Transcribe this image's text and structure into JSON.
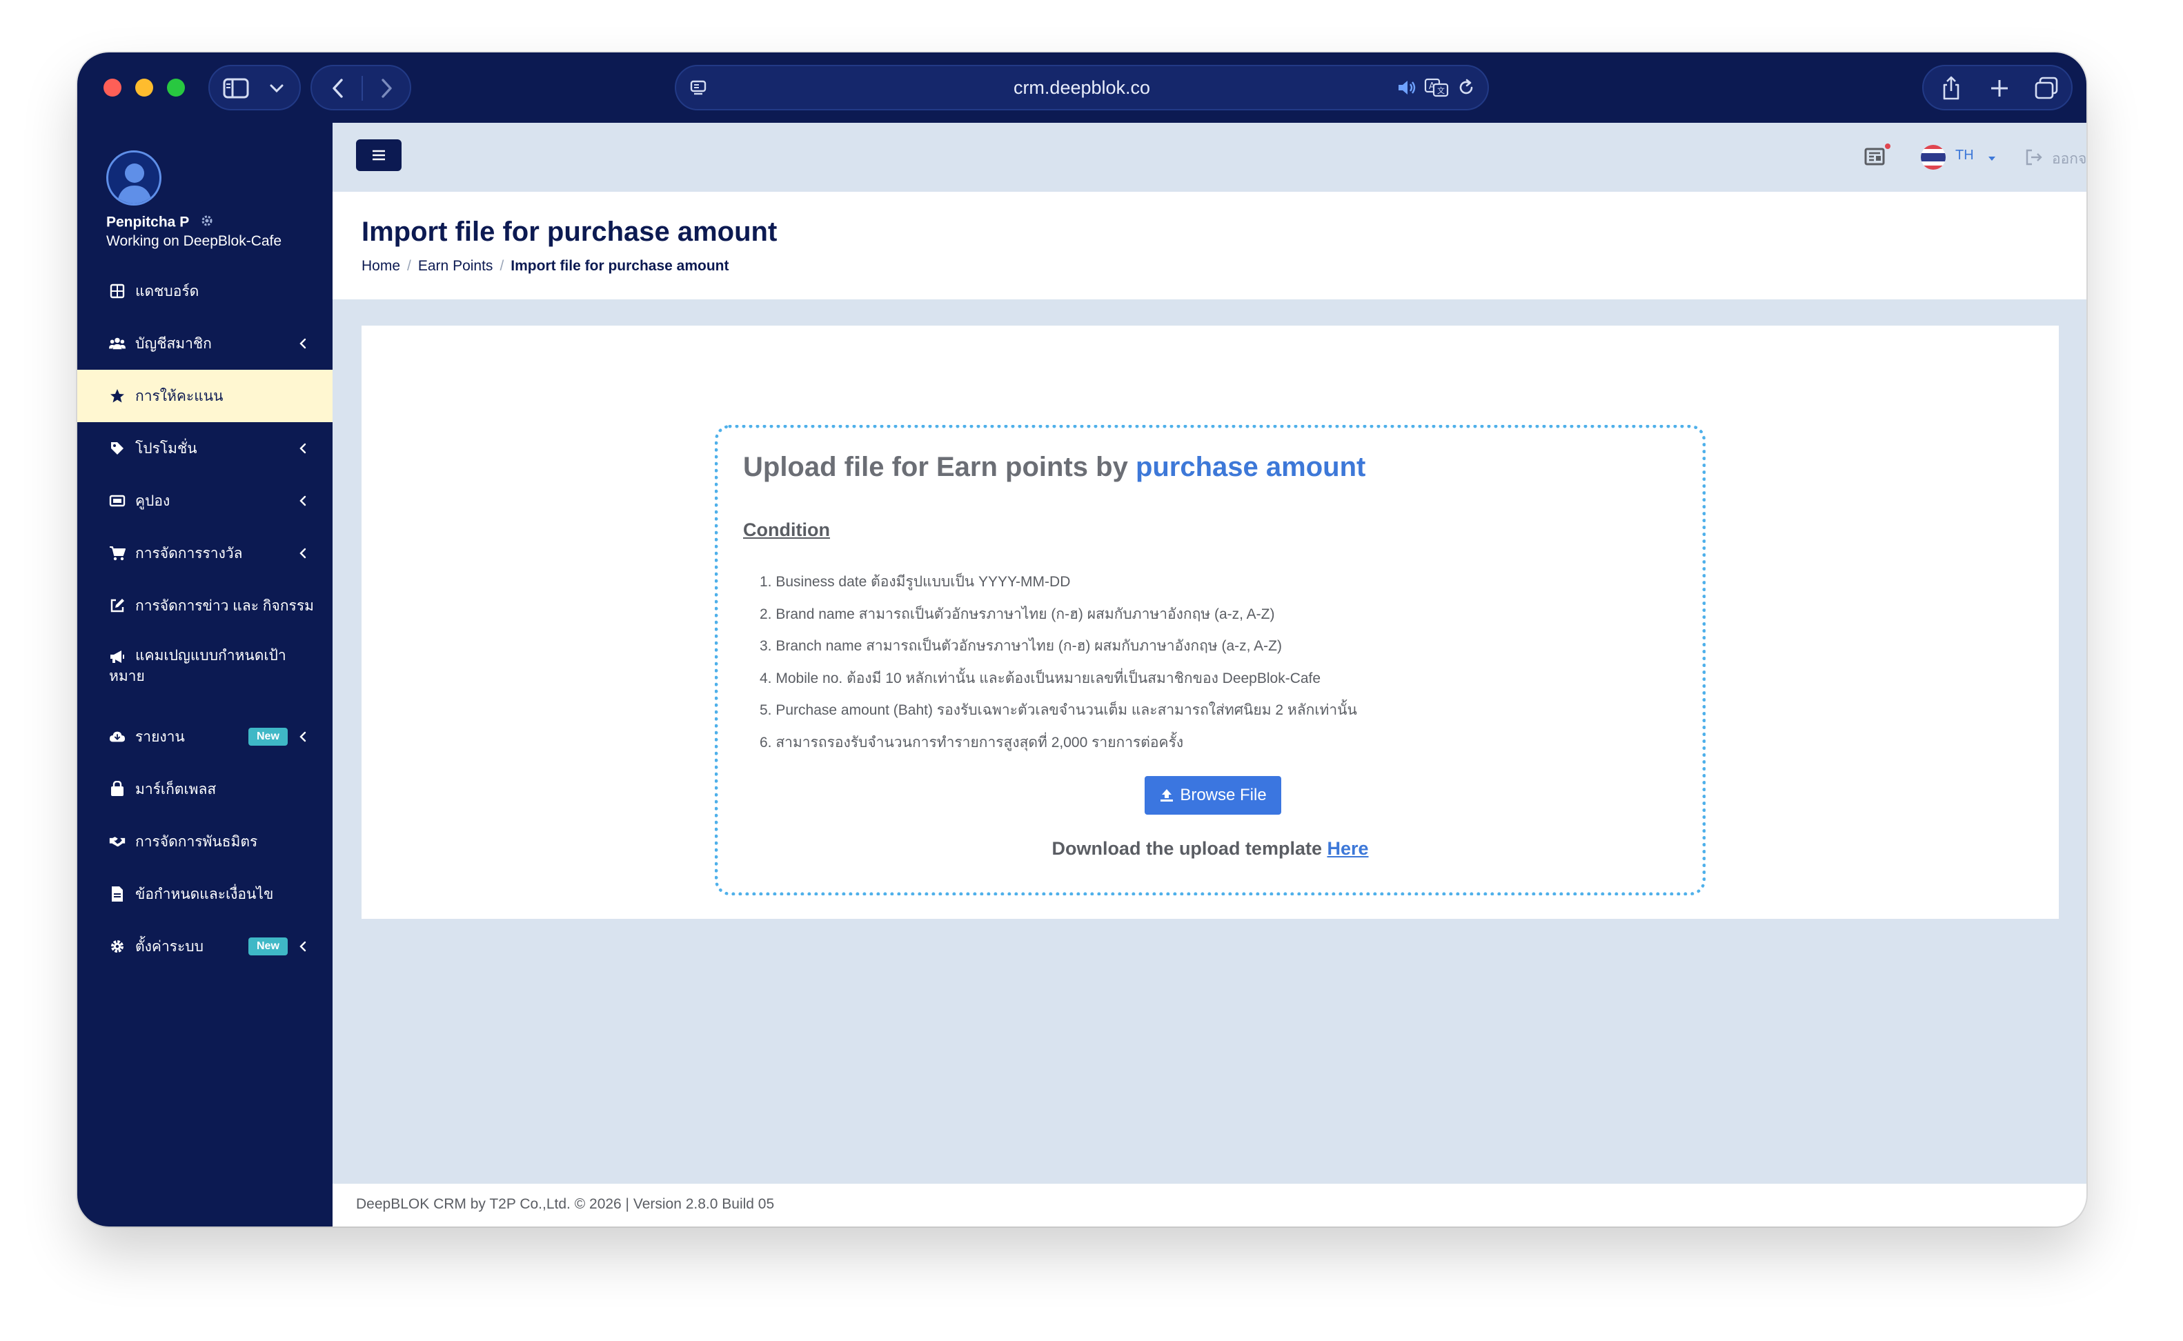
{
  "browser": {
    "url": "crm.deepblok.co"
  },
  "sidebar": {
    "user_name": "Penpitcha P",
    "workspace": "Working on DeepBlok-Cafe",
    "items": [
      {
        "label": "แดชบอร์ด",
        "icon": "dashboard-icon",
        "chevron": false,
        "badge": "",
        "active": false
      },
      {
        "label": "บัญชีสมาชิก",
        "icon": "users-icon",
        "chevron": true,
        "badge": "",
        "active": false
      },
      {
        "label": "การให้คะแนน",
        "icon": "star-icon",
        "chevron": false,
        "badge": "",
        "active": true
      },
      {
        "label": "โปรโมชั่น",
        "icon": "tag-icon",
        "chevron": true,
        "badge": "",
        "active": false
      },
      {
        "label": "คูปอง",
        "icon": "ticket-icon",
        "chevron": true,
        "badge": "",
        "active": false
      },
      {
        "label": "การจัดการรางวัล",
        "icon": "cart-icon",
        "chevron": true,
        "badge": "",
        "active": false
      },
      {
        "label": "การจัดการข่าว และ กิจกรรม",
        "icon": "edit-icon",
        "chevron": false,
        "badge": "",
        "active": false
      },
      {
        "label": "แคมเปญแบบกำหนดเป้าหมาย",
        "icon": "megaphone-icon",
        "chevron": false,
        "badge": "",
        "active": false
      },
      {
        "label": "รายงาน",
        "icon": "cloud-download-icon",
        "chevron": true,
        "badge": "New",
        "active": false
      },
      {
        "label": "มาร์เก็ตเพลส",
        "icon": "shopping-bag-icon",
        "chevron": false,
        "badge": "",
        "active": false
      },
      {
        "label": "การจัดการพันธมิตร",
        "icon": "handshake-icon",
        "chevron": false,
        "badge": "",
        "active": false
      },
      {
        "label": "ข้อกำหนดและเงื่อนไข",
        "icon": "document-icon",
        "chevron": false,
        "badge": "",
        "active": false
      },
      {
        "label": "ตั้งค่าระบบ",
        "icon": "gear-icon",
        "chevron": true,
        "badge": "New",
        "active": false
      }
    ]
  },
  "topbar": {
    "language": "TH",
    "logout_label": "ออกจากระบบ"
  },
  "page": {
    "title": "Import file for purchase amount",
    "breadcrumb": [
      "Home",
      "Earn Points",
      "Import file for purchase amount"
    ]
  },
  "upload": {
    "title_prefix": "Upload file for Earn points by",
    "title_highlight": "purchase amount",
    "condition_title": "Condition",
    "conditions": [
      "Business date ต้องมีรูปแบบเป็น YYYY-MM-DD",
      "Brand name สามารถเป็นตัวอักษรภาษาไทย (ก-ฮ) ผสมกับภาษาอังกฤษ (a-z, A-Z)",
      "Branch name สามารถเป็นตัวอักษรภาษาไทย (ก-ฮ) ผสมกับภาษาอังกฤษ (a-z, A-Z)",
      "Mobile no. ต้องมี 10 หลักเท่านั้น และต้องเป็นหมายเลขที่เป็นสมาชิกของ DeepBlok-Cafe",
      "Purchase amount (Baht) รองรับเฉพาะตัวเลขจำนวนเต็ม และสามารถใส่ทศนิยม 2 หลักเท่านั้น",
      "สามารถรองรับจำนวนการทำรายการสูงสุดที่ 2,000 รายการต่อครั้ง"
    ],
    "browse_label": "Browse File",
    "download_prefix": "Download the upload template",
    "download_link": "Here"
  },
  "footer": {
    "text": "DeepBLOK CRM by T2P Co.,Ltd. © 2026 | Version 2.8.0 Build 05"
  },
  "colors": {
    "navy": "#0c1a52",
    "accent_blue": "#3b76e0",
    "active_bg": "#fff7d1",
    "badge_teal": "#3fb8c6",
    "dotted_border": "#4fb0ea"
  }
}
